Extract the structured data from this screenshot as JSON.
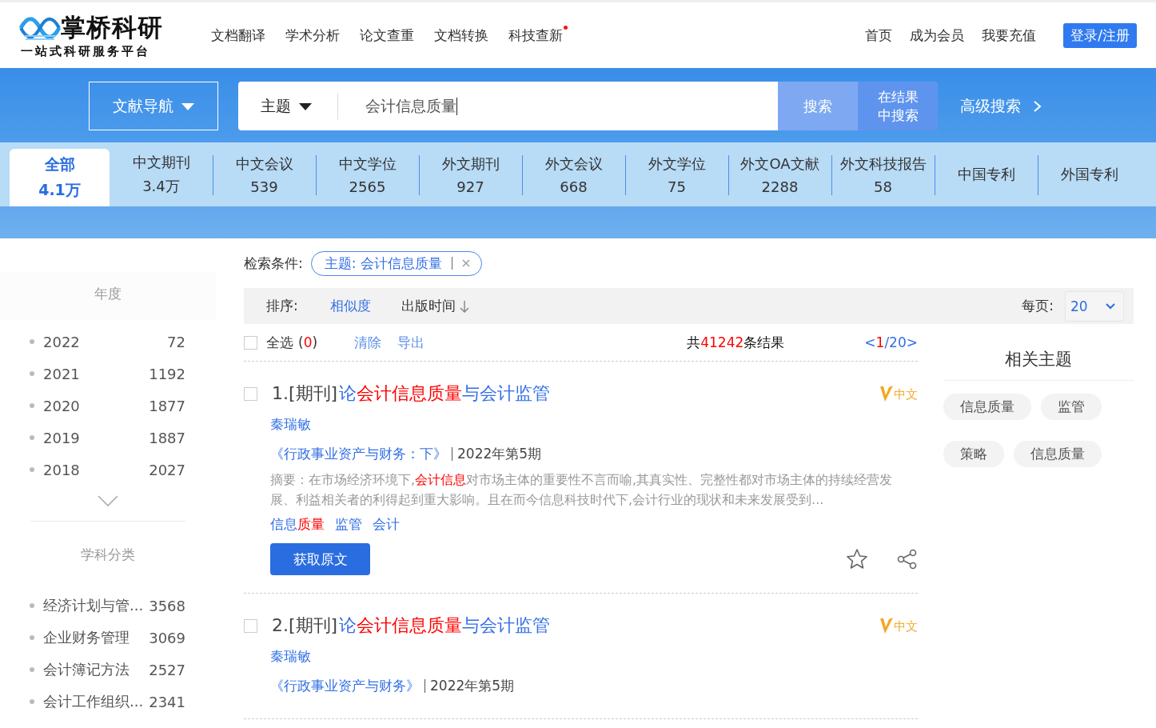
{
  "header": {
    "logo": {
      "name": "掌桥科研",
      "tagline": "一站式科研服务平台"
    },
    "nav": [
      {
        "label": "文档翻译",
        "dot": false
      },
      {
        "label": "学术分析",
        "dot": false
      },
      {
        "label": "论文查重",
        "dot": false
      },
      {
        "label": "文档转换",
        "dot": false
      },
      {
        "label": "科技查新",
        "dot": true
      }
    ],
    "links": [
      "首页",
      "成为会员",
      "我要充值"
    ],
    "login_button": "登录/注册"
  },
  "search": {
    "nav_button": "文献导航",
    "field_dropdown": "主题",
    "query": "会计信息质量",
    "search_button": "搜索",
    "search_within_button": "在结果中搜索",
    "advanced_link": "高级搜索"
  },
  "tabs": [
    {
      "label": "全部",
      "count": "4.1万",
      "selected": true
    },
    {
      "label": "中文期刊",
      "count": "3.4万",
      "selected": false
    },
    {
      "label": "中文会议",
      "count": "539",
      "selected": false
    },
    {
      "label": "中文学位",
      "count": "2565",
      "selected": false
    },
    {
      "label": "外文期刊",
      "count": "927",
      "selected": false
    },
    {
      "label": "外文会议",
      "count": "668",
      "selected": false
    },
    {
      "label": "外文学位",
      "count": "75",
      "selected": false
    },
    {
      "label": "外文OA文献",
      "count": "2288",
      "selected": false
    },
    {
      "label": "外文科技报告",
      "count": "58",
      "selected": false
    },
    {
      "label": "中国专利",
      "selected": false
    },
    {
      "label": "外国专利",
      "selected": false
    }
  ],
  "sidebar": [
    {
      "title": "年度",
      "more": true,
      "items": [
        {
          "label": "2022",
          "count": "72"
        },
        {
          "label": "2021",
          "count": "1192"
        },
        {
          "label": "2020",
          "count": "1877"
        },
        {
          "label": "2019",
          "count": "1887"
        },
        {
          "label": "2018",
          "count": "2027"
        }
      ]
    },
    {
      "title": "学科分类",
      "more": false,
      "items": [
        {
          "label": "经济计划与管...",
          "count": "3568"
        },
        {
          "label": "企业财务管理",
          "count": "3069"
        },
        {
          "label": "会计簿记方法",
          "count": "2527"
        },
        {
          "label": "会计工作组织...",
          "count": "2341"
        }
      ]
    }
  ],
  "criteria": {
    "label": "检索条件:",
    "chips": [
      {
        "text": "主题: 会计信息质量"
      }
    ]
  },
  "sort": {
    "label": "排序:",
    "options": [
      {
        "label": "相似度",
        "selected": true,
        "arrow": false
      },
      {
        "label": "出版时间",
        "selected": false,
        "arrow": true
      }
    ],
    "per_page_label": "每页:",
    "per_page": "20"
  },
  "selection": {
    "checked": false,
    "select_all": "全选",
    "count": [
      {
        "text": "(",
        "highlight": false
      },
      {
        "text": "0",
        "highlight": true
      },
      {
        "text": ")",
        "highlight": false
      }
    ],
    "actions": [
      "清除",
      "导出"
    ],
    "total": [
      {
        "text": "共",
        "highlight": false
      },
      {
        "text": "41242",
        "highlight": true
      },
      {
        "text": "条结果",
        "highlight": false
      }
    ],
    "pager": [
      {
        "text": "<",
        "highlight": false
      },
      {
        "text": "1",
        "highlight": true
      },
      {
        "text": "/20>",
        "highlight": false
      }
    ]
  },
  "results": [
    {
      "checked": false,
      "label": "1.[期刊]",
      "title": [
        {
          "text": "论",
          "highlight": false
        },
        {
          "text": "会计信息质量",
          "highlight": true
        },
        {
          "text": "与会计监管",
          "highlight": false
        }
      ],
      "badge": "中文",
      "author": "秦瑞敏",
      "journal": "《行政事业资产与财务：下》",
      "issue": "2022年第5期",
      "abstract": [
        {
          "text": "摘要：在市场经济环境下,",
          "highlight": false
        },
        {
          "text": "会计信息",
          "highlight": true
        },
        {
          "text": "对市场主体的重要性不言而喻,其真实性、完整性都对市场主体的持续经营发展、利益相关者的利得起到重大影响。且在而今信息科技时代下,会计行业的现状和未来发展受到...",
          "highlight": false
        }
      ],
      "keywords": [
        [
          {
            "text": "信息",
            "highlight": false
          },
          {
            "text": "质量",
            "highlight": true
          }
        ],
        [
          {
            "text": "监管",
            "highlight": false
          }
        ],
        [
          {
            "text": "会计",
            "highlight": false
          }
        ]
      ],
      "button": "获取原文"
    },
    {
      "checked": false,
      "label": "2.[期刊]",
      "title": [
        {
          "text": "论",
          "highlight": false
        },
        {
          "text": "会计信息质量",
          "highlight": true
        },
        {
          "text": "与会计监管",
          "highlight": false
        }
      ],
      "badge": "中文",
      "author": "秦瑞敏",
      "journal": "《行政事业资产与财务》",
      "issue": "2022年第5期"
    }
  ],
  "related": {
    "title": "相关主题",
    "tags": [
      "信息质量",
      "监管",
      "策略",
      "信息质量"
    ]
  }
}
